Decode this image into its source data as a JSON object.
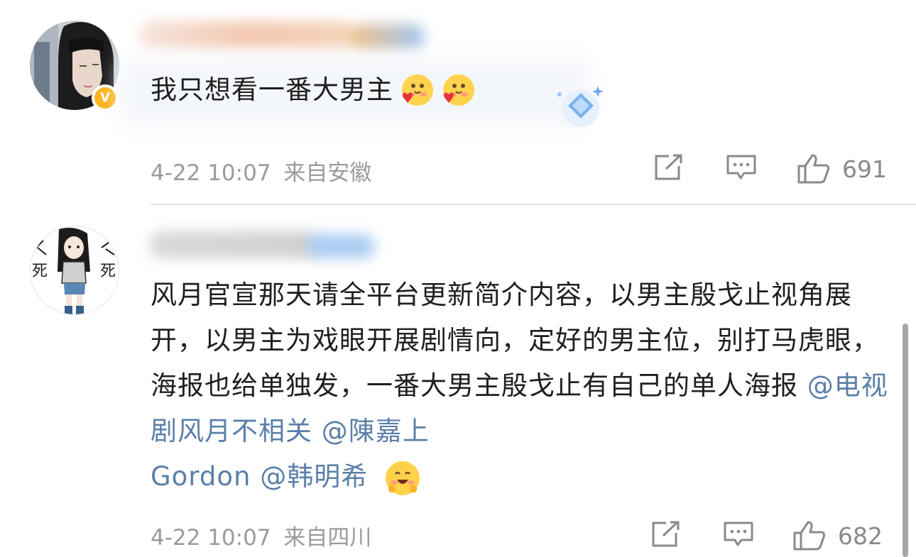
{
  "comments": [
    {
      "text": "我只想看一番大男主",
      "timestamp": "4-22 10:07",
      "location": "来自安徽",
      "like_count": "691",
      "verified_mark": "V"
    },
    {
      "text": "风月官宣那天请全平台更新简介内容，以男主殷戈止视角展开，以男主为戏眼开展剧情向，定好的男主位，别打马虎眼，海报也给单独发，一番大男主殷戈止有自己的单人海报",
      "mention_1": "@电视剧风月不相关",
      "mention_2": "@陳嘉上",
      "mention_3": "Gordon",
      "mention_4": "@韩明希",
      "timestamp": "4-22 10:07",
      "location": "来自四川",
      "like_count": "682",
      "avatar_text_left": "死",
      "avatar_text_right": "死"
    }
  ],
  "icons": {
    "share": "share-icon",
    "comment": "comment-icon",
    "like": "thumbs-up-icon",
    "emoji": "blushing-heart-emoji"
  },
  "colors": {
    "mention": "#5b7fa8",
    "meta": "#9b9b9b",
    "verified": "#ffb41f"
  }
}
